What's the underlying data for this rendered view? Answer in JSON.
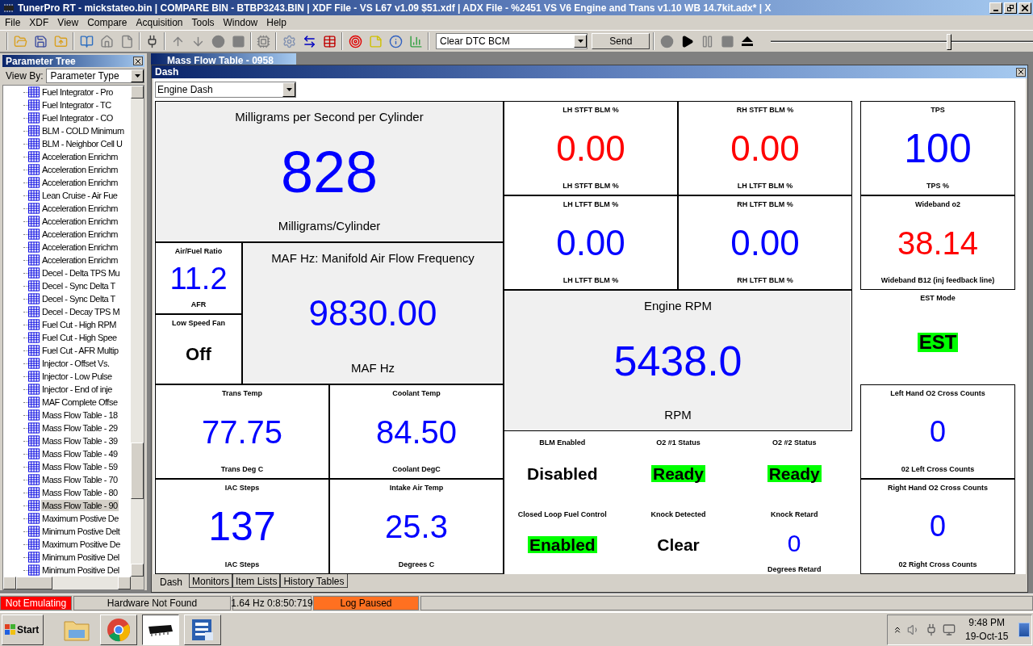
{
  "window": {
    "title": "TunerPro RT - mickstateo.bin | COMPARE BIN - BTBP3243.BIN | XDF File - VS L67 v1.09 $51.xdf | ADX File - %2451 VS V6 Engine and Trans v1.10 WB 14.7kit.adx* | X"
  },
  "menu": [
    "File",
    "XDF",
    "View",
    "Compare",
    "Acquisition",
    "Tools",
    "Window",
    "Help"
  ],
  "toolbar": {
    "command": "Clear DTC BCM",
    "send": "Send",
    "playback_slider": {
      "level": 0.68
    }
  },
  "parameter_tree": {
    "title": "Parameter Tree",
    "view_by_label": "View By:",
    "view_by": "Parameter Type",
    "items": [
      {
        "label": "Fuel Integrator - Pro",
        "selected": false
      },
      {
        "label": "Fuel Integrator - TC",
        "selected": false
      },
      {
        "label": "Fuel Integrator - CO",
        "selected": false
      },
      {
        "label": "BLM - COLD Minimum",
        "selected": false
      },
      {
        "label": "BLM - Neighbor Cell U",
        "selected": false
      },
      {
        "label": "Acceleration Enrichm",
        "selected": false
      },
      {
        "label": "Acceleration Enrichm",
        "selected": false
      },
      {
        "label": "Acceleration Enrichm",
        "selected": false
      },
      {
        "label": "Lean Cruise - Air Fue",
        "selected": false
      },
      {
        "label": "Acceleration Enrichm",
        "selected": false
      },
      {
        "label": "Acceleration Enrichm",
        "selected": false
      },
      {
        "label": "Acceleration Enrichm",
        "selected": false
      },
      {
        "label": "Acceleration Enrichm",
        "selected": false
      },
      {
        "label": "Acceleration Enrichm",
        "selected": false
      },
      {
        "label": "Decel - Delta TPS Mu",
        "selected": false
      },
      {
        "label": "Decel - Sync Delta T",
        "selected": false
      },
      {
        "label": "Decel - Sync Delta T",
        "selected": false
      },
      {
        "label": "Decel - Decay TPS M",
        "selected": false
      },
      {
        "label": "Fuel Cut - High RPM",
        "selected": false
      },
      {
        "label": "Fuel Cut - High Spee",
        "selected": false
      },
      {
        "label": "Fuel Cut - AFR Multip",
        "selected": false
      },
      {
        "label": "Injector - Offset Vs.",
        "selected": false
      },
      {
        "label": "Injector - Low Pulse",
        "selected": false
      },
      {
        "label": "Injector - End of inje",
        "selected": false
      },
      {
        "label": "MAF Complete Offse",
        "selected": false
      },
      {
        "label": "Mass Flow Table - 18",
        "selected": false
      },
      {
        "label": "Mass Flow Table - 29",
        "selected": false
      },
      {
        "label": "Mass Flow Table - 39",
        "selected": false
      },
      {
        "label": "Mass Flow Table - 49",
        "selected": false
      },
      {
        "label": "Mass Flow Table - 59",
        "selected": false
      },
      {
        "label": "Mass Flow Table - 70",
        "selected": false
      },
      {
        "label": "Mass Flow Table - 80",
        "selected": false
      },
      {
        "label": "Mass Flow Table - 90",
        "selected": true
      },
      {
        "label": "Maximum Postive De",
        "selected": false
      },
      {
        "label": "Minimum Postive Delt",
        "selected": false
      },
      {
        "label": "Maximum Positive De",
        "selected": false
      },
      {
        "label": "Minimum Positive Del",
        "selected": false
      },
      {
        "label": "Minimum Positive Del",
        "selected": false
      }
    ]
  },
  "background_window": {
    "title": "Mass Flow Table - 0958"
  },
  "dash": {
    "title": "Dash",
    "layout": "Engine Dash",
    "gauges": [
      {
        "kind": "large",
        "title": "Milligrams per Second per Cylinder",
        "value": "828",
        "units": "Milligrams/Cylinder",
        "color": "#0000ff",
        "highlighted": false
      },
      {
        "kind": "small",
        "title": "LH STFT BLM %",
        "value": "0.00",
        "units": "LH STFT BLM %",
        "color": "#ff0000",
        "highlighted": false
      },
      {
        "kind": "small",
        "title": "RH STFT BLM %",
        "value": "0.00",
        "units": "LH LTFT BLM %",
        "color": "#ff0000",
        "highlighted": false
      },
      {
        "kind": "small",
        "title": "TPS",
        "value": "100",
        "units": "TPS %",
        "color": "#0000ff",
        "highlighted": false
      },
      {
        "kind": "small",
        "title": "Air/Fuel Ratio",
        "value": "11.2",
        "units": "AFR",
        "color": "#0000ff",
        "highlighted": false
      },
      {
        "kind": "large",
        "title": "MAF Hz: Manifold Air Flow Frequency",
        "value": "9830.00",
        "units": "MAF Hz",
        "color": "#0000ff",
        "highlighted": false
      },
      {
        "kind": "small",
        "title": "LH LTFT BLM %",
        "value": "0.00",
        "units": "LH LTFT BLM %",
        "color": "#0000ff",
        "highlighted": false
      },
      {
        "kind": "small",
        "title": "RH LTFT BLM %",
        "value": "0.00",
        "units": "RH LTFT BLM %",
        "color": "#0000ff",
        "highlighted": false
      },
      {
        "kind": "small",
        "title": "Wideband o2",
        "value": "38.14",
        "units": "Wideband B12 (inj feedback line)",
        "color": "#ff0000",
        "highlighted": false
      },
      {
        "kind": "large",
        "title": "Engine RPM",
        "value": "5438.0",
        "units": "RPM",
        "color": "#0000ff",
        "highlighted": false
      },
      {
        "kind": "small",
        "title": "EST Mode",
        "value": "EST",
        "highlighted": true
      },
      {
        "kind": "small",
        "title": "Low Speed Fan",
        "value": "Off",
        "color": "#000000",
        "highlighted": false
      },
      {
        "kind": "small",
        "title": "Trans Temp",
        "value": "77.75",
        "units": "Trans Deg C",
        "color": "#0000ff",
        "highlighted": false
      },
      {
        "kind": "small",
        "title": "Coolant Temp",
        "value": "84.50",
        "units": "Coolant DegC",
        "color": "#0000ff",
        "highlighted": false
      },
      {
        "kind": "small",
        "title": "Left Hand O2 Cross Counts",
        "value": "0",
        "units": "02 Left Cross Counts",
        "color": "#0000ff",
        "highlighted": false
      },
      {
        "kind": "small",
        "title": "IAC Steps",
        "value": "137",
        "units": "IAC Steps",
        "color": "#0000ff",
        "highlighted": false
      },
      {
        "kind": "small",
        "title": "Intake Air Temp",
        "value": "25.3",
        "units": "Degrees C",
        "color": "#0000ff",
        "highlighted": false
      },
      {
        "kind": "small",
        "title": "Right Hand O2 Cross Counts",
        "value": "0",
        "units": "02 Right Cross Counts",
        "color": "#0000ff",
        "highlighted": false
      }
    ],
    "status_panel": [
      {
        "title": "BLM Enabled",
        "value": "Disabled",
        "color": "#000000",
        "highlighted": false
      },
      {
        "title": "O2 #1 Status",
        "value": "Ready",
        "highlighted": true
      },
      {
        "title": "O2 #2 Status",
        "value": "Ready",
        "highlighted": true
      },
      {
        "title": "Closed Loop Fuel Control",
        "value": "Enabled",
        "highlighted": true
      },
      {
        "title": "Knock Detected",
        "value": "Clear",
        "color": "#000000",
        "highlighted": false
      },
      {
        "title": "Knock Retard",
        "value": "0",
        "units": "Degrees Retard",
        "color": "#0000ff",
        "highlighted": false
      }
    ],
    "tabs": [
      {
        "label": "Dash",
        "selected": true
      },
      {
        "label": "Monitors",
        "selected": false
      },
      {
        "label": "Item Lists",
        "selected": false
      },
      {
        "label": "History Tables",
        "selected": false
      }
    ]
  },
  "status_bar": [
    {
      "text": "Not Emulating",
      "color": "#ff0000"
    },
    {
      "text": "Hardware Not Found",
      "color": "#d4d0c8"
    },
    {
      "text": "1.64 Hz  0:8:50:719",
      "color": "#d4d0c8"
    },
    {
      "text": "Log Paused",
      "color": "#ff7020"
    }
  ],
  "taskbar": {
    "start": "Start",
    "time": "9:48 PM",
    "date": "19-Oct-15"
  }
}
